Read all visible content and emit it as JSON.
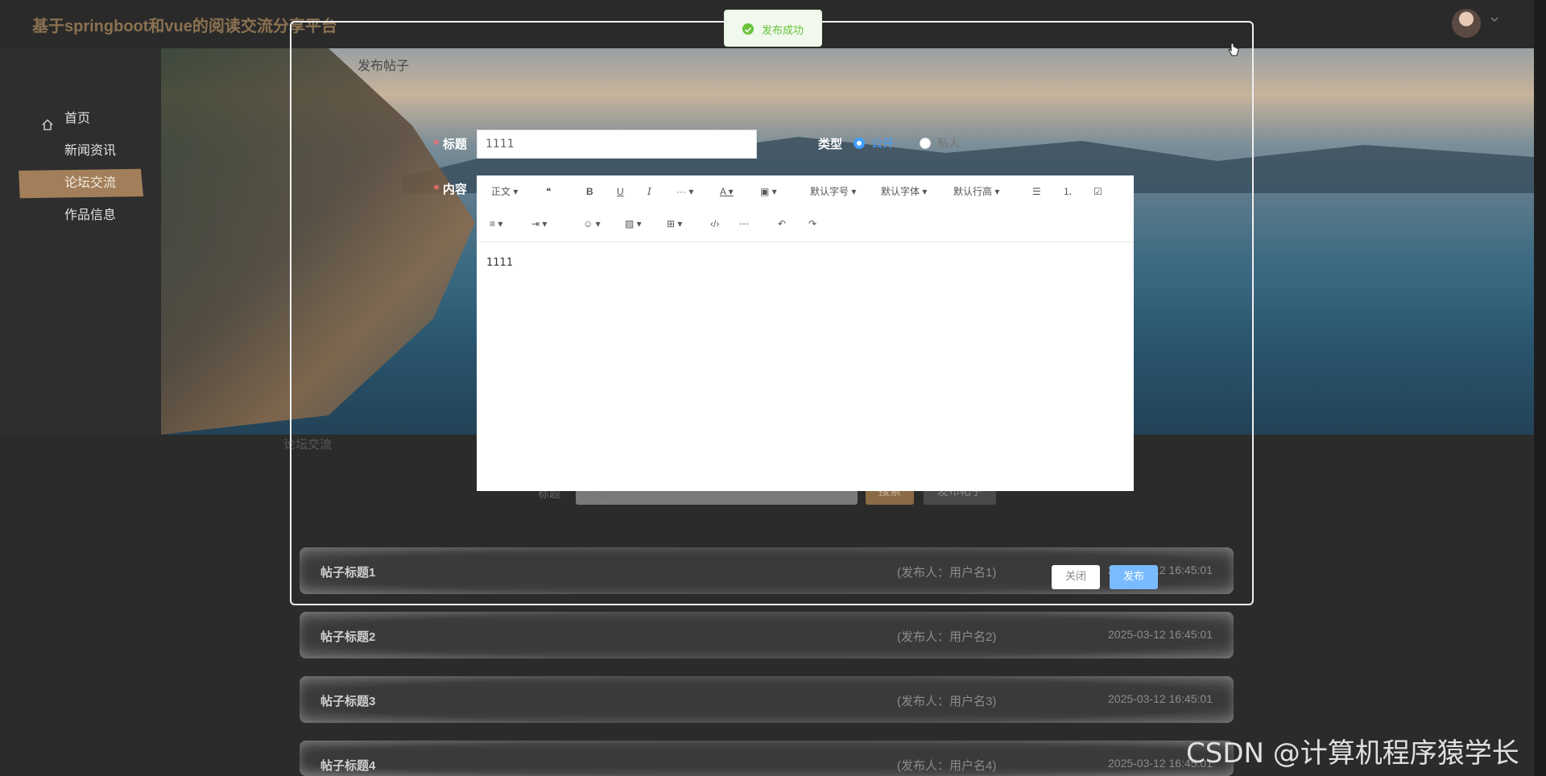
{
  "header": {
    "title": "基于springboot和vue的阅读交流分享平台"
  },
  "sidebar": {
    "items": [
      {
        "label": "首页"
      },
      {
        "label": "新闻资讯"
      },
      {
        "label": "论坛交流"
      },
      {
        "label": "作品信息"
      }
    ]
  },
  "forum": {
    "heading": "论坛交流",
    "search_label": "标题",
    "search_placeholder": "标题",
    "search_button": "搜索",
    "post_button": "发布帖子",
    "posts": [
      {
        "title": "帖子标题1",
        "author": "(发布人：用户名1)",
        "date": "2025-03-12 16:45:01"
      },
      {
        "title": "帖子标题2",
        "author": "(发布人：用户名2)",
        "date": "2025-03-12 16:45:01"
      },
      {
        "title": "帖子标题3",
        "author": "(发布人：用户名3)",
        "date": "2025-03-12 16:45:01"
      },
      {
        "title": "帖子标题4",
        "author": "(发布人：用户名4)",
        "date": "2025-03-12 16:45:01"
      }
    ]
  },
  "dialog": {
    "title": "发布帖子",
    "title_label": "标题",
    "title_value": "1111",
    "type_label": "类型",
    "type_options": [
      "公开",
      "私人"
    ],
    "content_label": "内容",
    "content_value": "1111",
    "toolbar": {
      "paragraph": "正文",
      "font_size": "默认字号",
      "font_family": "默认字体",
      "line_height": "默认行高"
    },
    "close_button": "关闭",
    "publish_button": "发布"
  },
  "toast": {
    "message": "发布成功"
  },
  "watermark": "CSDN @计算机程序猿学长",
  "colors": {
    "accent": "#a27f5a",
    "primary": "#409eff",
    "success": "#67c23a"
  }
}
